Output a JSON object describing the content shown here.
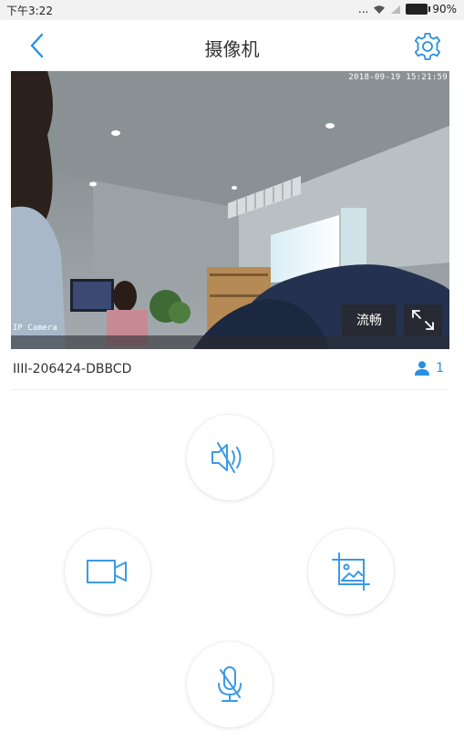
{
  "status_bar": {
    "time": "下午3:22",
    "dots": "...",
    "battery": "90%"
  },
  "header": {
    "title": "摄像机",
    "back_icon": "chevron-left-icon",
    "settings_icon": "gear-icon"
  },
  "video": {
    "timestamp": "2018-09-19 15:21:59",
    "camera_label": "IP Camera",
    "quality_label": "流畅",
    "fullscreen_icon": "expand-icon"
  },
  "device": {
    "id": "IIII-206424-DBBCD",
    "viewer_count": "1",
    "viewer_icon": "person-icon"
  },
  "controls": {
    "mute_icon": "speaker-muted-icon",
    "record_icon": "video-camera-icon",
    "snapshot_icon": "picture-icon",
    "talk_icon": "microphone-icon"
  },
  "colors": {
    "accent": "#2a8fe0",
    "icon": "#3a9ae8"
  }
}
